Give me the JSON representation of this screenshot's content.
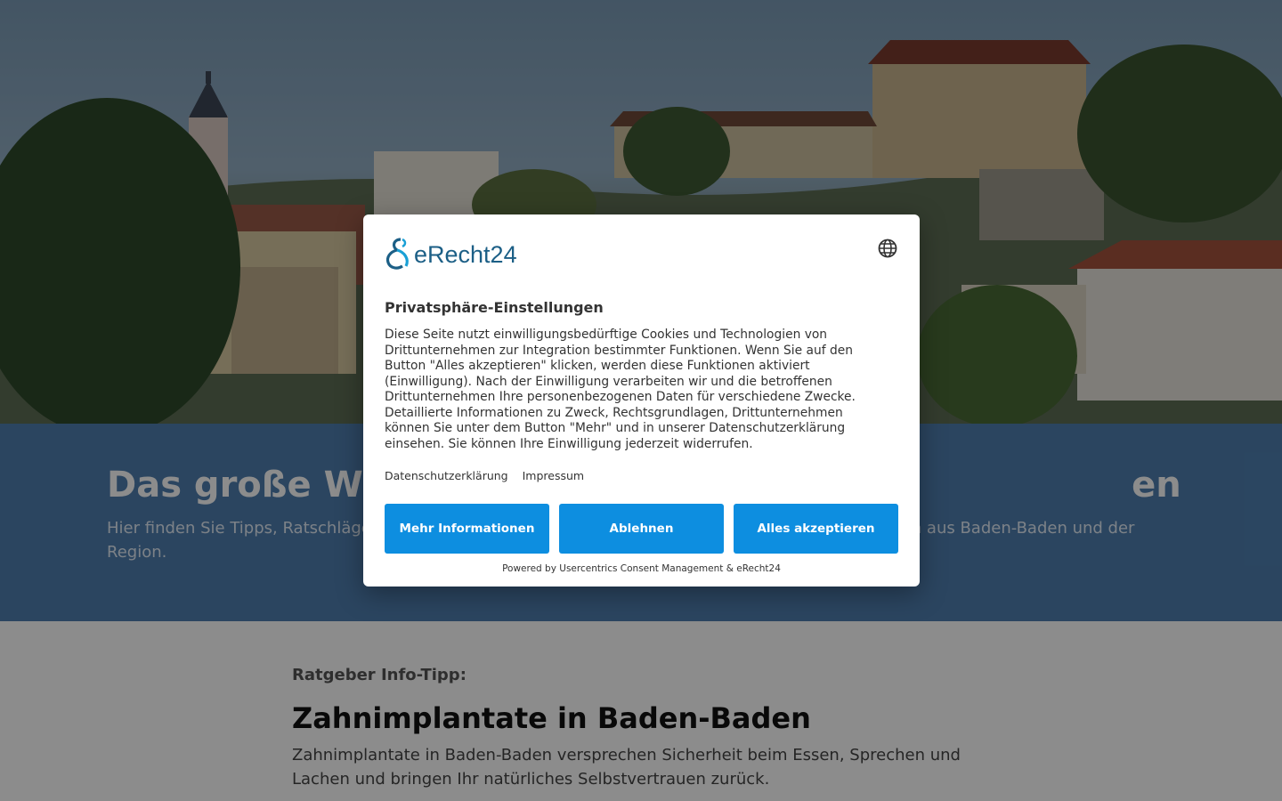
{
  "hero": {
    "image_description": "Panoramic view of Baden-Baden old town with castle and church tower",
    "sky_color": "#8aa7bf"
  },
  "band": {
    "title": "Das große W                                                              en",
    "subtitle": "Hier finden Sie Tipps, Ratschläge                                                                                      en Fachleuten aus Baden-Baden und der Region.",
    "color": "#4f7fb0"
  },
  "content": {
    "kicker": "Ratgeber Info-Tipp:",
    "title": "Zahnimplantate in Baden-Baden",
    "text": "Zahnimplantate in Baden-Baden versprechen Sicherheit beim Essen, Sprechen und Lachen und bringen Ihr natürliches Selbstvertrauen zurück."
  },
  "modal": {
    "logo_text": "eRecht24",
    "language_icon": "globe-icon",
    "title": "Privatsphäre-Einstellungen",
    "text": "Diese Seite nutzt einwilligungsbedürftige Cookies und Technologien von Drittunternehmen zur Integration bestimmter Funktionen. Wenn Sie auf den Button \"Alles akzeptieren\" klicken, werden diese Funktionen aktiviert (Einwilligung). Nach der Einwilligung verarbeiten wir und die betroffenen Drittunternehmen Ihre personenbezogenen Daten für verschiedene Zwecke. Detaillierte Informationen zu Zweck, Rechtsgrundlagen, Drittunternehmen können Sie unter dem Button \"Mehr\" und in unserer Datenschutzerklärung einsehen. Sie können Ihre Einwilligung jederzeit widerrufen.",
    "links": {
      "privacy": "Datenschutzerklärung",
      "imprint": "Impressum"
    },
    "buttons": {
      "more": "Mehr Informationen",
      "deny": "Ablehnen",
      "accept": "Alles akzeptieren"
    },
    "powered_by": "Powered by Usercentrics Consent Management & eRecht24",
    "accent_color": "#0d8ee0"
  }
}
